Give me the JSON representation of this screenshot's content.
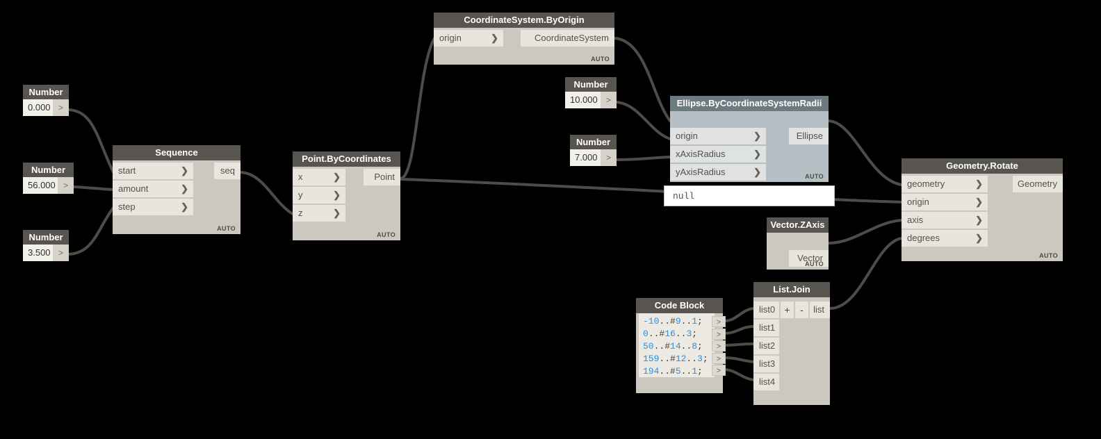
{
  "graph": {
    "background": "#000000",
    "wire_color": "#4f4c47",
    "accent_selected": "#6d7b81",
    "code_number_color": "#2c8fe0",
    "auto_label": "AUTO",
    "caret_glyph": "❯",
    "number_button_glyph": ">"
  },
  "number_nodes": [
    {
      "id": "num-0",
      "title": "Number",
      "value": "0.000",
      "button": ">"
    },
    {
      "id": "num-56",
      "title": "Number",
      "value": "56.000",
      "button": ">"
    },
    {
      "id": "num-35",
      "title": "Number",
      "value": "3.500",
      "button": ">"
    },
    {
      "id": "num-10",
      "title": "Number",
      "value": "10.000",
      "button": ">"
    },
    {
      "id": "num-7",
      "title": "Number",
      "value": "7.000",
      "button": ">"
    }
  ],
  "nodes": {
    "sequence": {
      "title": "Sequence",
      "inputs": [
        "start",
        "amount",
        "step"
      ],
      "outputs": [
        "seq"
      ],
      "auto": "AUTO"
    },
    "point_bycoordinates": {
      "title": "Point.ByCoordinates",
      "inputs": [
        "x",
        "y",
        "z"
      ],
      "outputs": [
        "Point"
      ],
      "auto": "AUTO"
    },
    "coordinatesystem_byorigin": {
      "title": "CoordinateSystem.ByOrigin",
      "inputs": [
        "origin"
      ],
      "outputs": [
        "CoordinateSystem"
      ],
      "auto": "AUTO"
    },
    "ellipse_bycoordinatesystemradii": {
      "title": "Ellipse.ByCoordinateSystemRadii",
      "inputs": [
        "origin",
        "xAxisRadius",
        "yAxisRadius"
      ],
      "outputs": [
        "Ellipse"
      ],
      "auto": "AUTO",
      "selected": true
    },
    "geometry_rotate": {
      "title": "Geometry.Rotate",
      "inputs": [
        "geometry",
        "origin",
        "axis",
        "degrees"
      ],
      "outputs": [
        "Geometry"
      ],
      "auto": "AUTO"
    },
    "vector_zaxis": {
      "title": "Vector.ZAxis",
      "inputs": [],
      "outputs": [
        "Vector"
      ],
      "auto": "AUTO"
    },
    "list_join": {
      "title": "List.Join",
      "inputs": [
        "list0",
        "list1",
        "list2",
        "list3",
        "list4"
      ],
      "outputs": [
        "list"
      ],
      "add_label": "+",
      "remove_label": "-"
    },
    "code_block": {
      "title": "Code Block",
      "lines": [
        [
          {
            "t": "-10",
            "c": "num"
          },
          {
            "t": "..#",
            "c": "op"
          },
          {
            "t": "9",
            "c": "num"
          },
          {
            "t": "..",
            "c": "op"
          },
          {
            "t": "1",
            "c": "num"
          },
          {
            "t": ";",
            "c": "op"
          }
        ],
        [
          {
            "t": "0",
            "c": "num"
          },
          {
            "t": "..#",
            "c": "op"
          },
          {
            "t": "16",
            "c": "num"
          },
          {
            "t": "..",
            "c": "op"
          },
          {
            "t": "3",
            "c": "num"
          },
          {
            "t": ";",
            "c": "op"
          }
        ],
        [
          {
            "t": "50",
            "c": "num"
          },
          {
            "t": "..#",
            "c": "op"
          },
          {
            "t": "14",
            "c": "num"
          },
          {
            "t": "..",
            "c": "op"
          },
          {
            "t": "8",
            "c": "num"
          },
          {
            "t": ";",
            "c": "op"
          }
        ],
        [
          {
            "t": "159",
            "c": "num"
          },
          {
            "t": "..#",
            "c": "op"
          },
          {
            "t": "12",
            "c": "num"
          },
          {
            "t": "..",
            "c": "op"
          },
          {
            "t": "3",
            "c": "num"
          },
          {
            "t": ";",
            "c": "op"
          }
        ],
        [
          {
            "t": "194",
            "c": "num"
          },
          {
            "t": "..#",
            "c": "op"
          },
          {
            "t": "5",
            "c": "num"
          },
          {
            "t": "..",
            "c": "op"
          },
          {
            "t": "1",
            "c": "num"
          },
          {
            "t": ";",
            "c": "op"
          }
        ]
      ],
      "output_glyph": ">",
      "output_count": 5
    }
  },
  "preview": {
    "value": "null"
  }
}
